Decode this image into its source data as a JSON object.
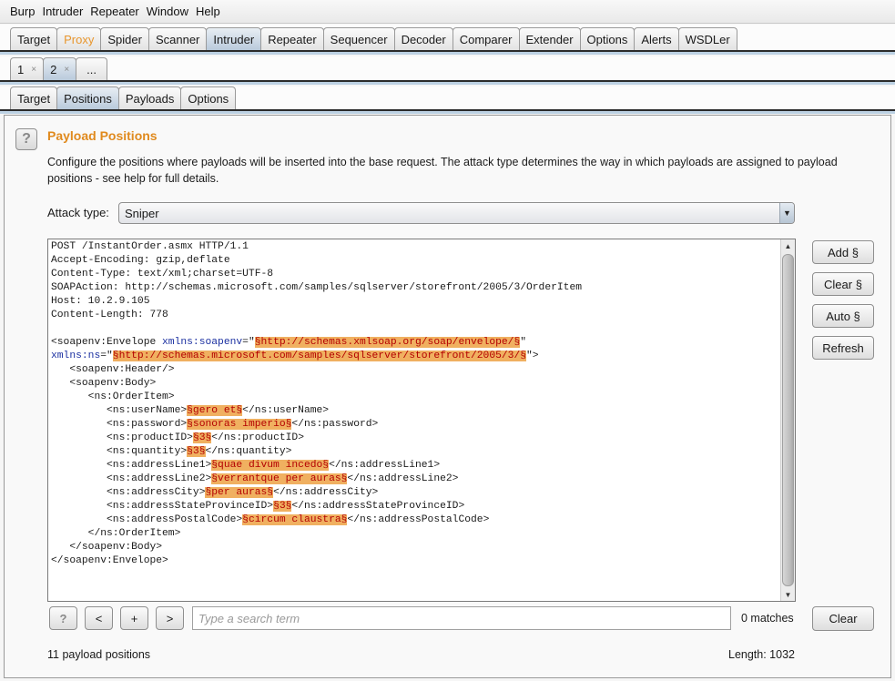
{
  "menubar": [
    "Burp",
    "Intruder",
    "Repeater",
    "Window",
    "Help"
  ],
  "main_tabs": [
    {
      "label": "Target",
      "active": false
    },
    {
      "label": "Proxy",
      "active": false,
      "highlight": true
    },
    {
      "label": "Spider",
      "active": false
    },
    {
      "label": "Scanner",
      "active": false
    },
    {
      "label": "Intruder",
      "active": true
    },
    {
      "label": "Repeater",
      "active": false
    },
    {
      "label": "Sequencer",
      "active": false
    },
    {
      "label": "Decoder",
      "active": false
    },
    {
      "label": "Comparer",
      "active": false
    },
    {
      "label": "Extender",
      "active": false
    },
    {
      "label": "Options",
      "active": false
    },
    {
      "label": "Alerts",
      "active": false
    },
    {
      "label": "WSDLer",
      "active": false
    }
  ],
  "attack_tabs": [
    {
      "label": "1",
      "close": "×",
      "active": false
    },
    {
      "label": "2",
      "close": "×",
      "active": true
    },
    {
      "label": "...",
      "close": "",
      "active": false
    }
  ],
  "sub_tabs": [
    {
      "label": "Target",
      "active": false
    },
    {
      "label": "Positions",
      "active": true
    },
    {
      "label": "Payloads",
      "active": false
    },
    {
      "label": "Options",
      "active": false
    }
  ],
  "panel": {
    "help_icon": "?",
    "title": "Payload Positions",
    "description": "Configure the positions where payloads will be inserted into the base request. The attack type determines the way in which payloads are assigned to payload positions - see help for full details.",
    "attack_type_label": "Attack type:",
    "attack_type_value": "Sniper",
    "dropdown_arrow": "▼"
  },
  "colors": {
    "title_orange": "#e08a1e",
    "payload_highlight": "#f0b060",
    "payload_text": "#b40000",
    "attr_blue": "#1a2fa0",
    "active_tab": "#b9cadb"
  },
  "request_lines": [
    [
      {
        "t": "POST /InstantOrder.asmx HTTP/1.1"
      }
    ],
    [
      {
        "t": "Accept-Encoding: gzip,deflate"
      }
    ],
    [
      {
        "t": "Content-Type: text/xml;charset=UTF-8"
      }
    ],
    [
      {
        "t": "SOAPAction: http://schemas.microsoft.com/samples/sqlserver/storefront/2005/3/OrderItem"
      }
    ],
    [
      {
        "t": "Host: 10.2.9.105"
      }
    ],
    [
      {
        "t": "Content-Length: 778"
      }
    ],
    [
      {
        "t": ""
      }
    ],
    [
      {
        "t": "<soapenv:Envelope "
      },
      {
        "t": "xmlns:soapenv",
        "c": "attr"
      },
      {
        "t": "=\""
      },
      {
        "t": "§http://schemas.xmlsoap.org/soap/envelope/§",
        "c": "pay"
      },
      {
        "t": "\""
      }
    ],
    [
      {
        "t": "xmlns:ns",
        "c": "attr"
      },
      {
        "t": "=\""
      },
      {
        "t": "§http://schemas.microsoft.com/samples/sqlserver/storefront/2005/3/§",
        "c": "pay"
      },
      {
        "t": "\">"
      }
    ],
    [
      {
        "t": "   <soapenv:Header/>"
      }
    ],
    [
      {
        "t": "   <soapenv:Body>"
      }
    ],
    [
      {
        "t": "      <ns:OrderItem>"
      }
    ],
    [
      {
        "t": "         <ns:userName>"
      },
      {
        "t": "§gero et§",
        "c": "pay"
      },
      {
        "t": "</ns:userName>"
      }
    ],
    [
      {
        "t": "         <ns:password>"
      },
      {
        "t": "§sonoras imperio§",
        "c": "pay"
      },
      {
        "t": "</ns:password>"
      }
    ],
    [
      {
        "t": "         <ns:productID>"
      },
      {
        "t": "§3§",
        "c": "pay"
      },
      {
        "t": "</ns:productID>"
      }
    ],
    [
      {
        "t": "         <ns:quantity>"
      },
      {
        "t": "§3§",
        "c": "pay"
      },
      {
        "t": "</ns:quantity>"
      }
    ],
    [
      {
        "t": "         <ns:addressLine1>"
      },
      {
        "t": "§quae divum incedo§",
        "c": "pay"
      },
      {
        "t": "</ns:addressLine1>"
      }
    ],
    [
      {
        "t": "         <ns:addressLine2>"
      },
      {
        "t": "§verrantque per auras§",
        "c": "pay"
      },
      {
        "t": "</ns:addressLine2>"
      }
    ],
    [
      {
        "t": "         <ns:addressCity>"
      },
      {
        "t": "§per auras§",
        "c": "pay"
      },
      {
        "t": "</ns:addressCity>"
      }
    ],
    [
      {
        "t": "         <ns:addressStateProvinceID>"
      },
      {
        "t": "§3§",
        "c": "pay"
      },
      {
        "t": "</ns:addressStateProvinceID>"
      }
    ],
    [
      {
        "t": "         <ns:addressPostalCode>"
      },
      {
        "t": "§circum claustra§",
        "c": "pay"
      },
      {
        "t": "</ns:addressPostalCode>"
      }
    ],
    [
      {
        "t": "      </ns:OrderItem>"
      }
    ],
    [
      {
        "t": "   </soapenv:Body>"
      }
    ],
    [
      {
        "t": "</soapenv:Envelope>"
      }
    ]
  ],
  "side_buttons": {
    "add": "Add §",
    "clear": "Clear §",
    "auto": "Auto §",
    "refresh": "Refresh"
  },
  "search_bar": {
    "help": "?",
    "prev": "<",
    "add": "+",
    "next": ">",
    "placeholder": "Type a search term",
    "value": "",
    "matches": "0 matches",
    "clear": "Clear"
  },
  "scrollbar": {
    "up": "▲",
    "down": "▼"
  },
  "status": {
    "positions": "11 payload positions",
    "length": "Length: 1032"
  }
}
